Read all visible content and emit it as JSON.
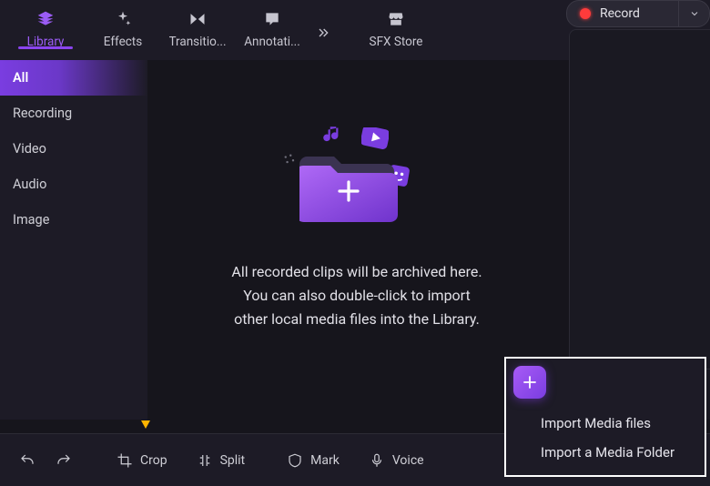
{
  "topbar": {
    "tabs": [
      {
        "label": "Library",
        "icon": "stack-icon",
        "active": true
      },
      {
        "label": "Effects",
        "icon": "sparkle-icon",
        "active": false
      },
      {
        "label": "Transitio...",
        "icon": "transition-icon",
        "active": false
      },
      {
        "label": "Annotati...",
        "icon": "annotation-icon",
        "active": false
      }
    ],
    "sfx_tab": {
      "label": "SFX Store",
      "icon": "storefront-icon"
    }
  },
  "record": {
    "label": "Record"
  },
  "sidebar": {
    "items": [
      {
        "label": "All",
        "active": true
      },
      {
        "label": "Recording",
        "active": false
      },
      {
        "label": "Video",
        "active": false
      },
      {
        "label": "Audio",
        "active": false
      },
      {
        "label": "Image",
        "active": false
      }
    ]
  },
  "main": {
    "empty_line1": "All recorded clips will be archived here.",
    "empty_line2": "You can also double-click to import",
    "empty_line3": "other local media files into the Library."
  },
  "toolbar": {
    "crop": "Crop",
    "split": "Split",
    "mark": "Mark",
    "voice": "Voice"
  },
  "import_popover": {
    "opt_files": "Import Media files",
    "opt_folder": "Import a Media Folder"
  }
}
